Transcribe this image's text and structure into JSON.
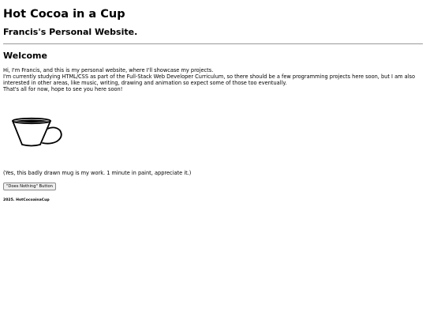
{
  "header": {
    "title": "Hot Cocoa in a Cup",
    "subtitle": "Francis's Personal Website."
  },
  "main": {
    "welcome_heading": "Welcome",
    "intro_lines": [
      "Hi, I'm Francis, and this is my personal website, where I'll showcase my projects.",
      "I'm currently studying HTML/CSS as part of the Full-Stack Web Developer Curriculum, so there should be a few programming projects here soon, but I am also interested in other areas, like music, writing, drawing and animation so expect some of those too eventually.",
      "That's all for now, hope to see you here soon!"
    ],
    "image_caption": "(Yes, this badly drawn mug is my work. 1 minute in paint, appreciate it.)",
    "button_label": "\"Does Nothing\" Button"
  },
  "footer": {
    "text": "2025. HotCocoainaCup"
  }
}
